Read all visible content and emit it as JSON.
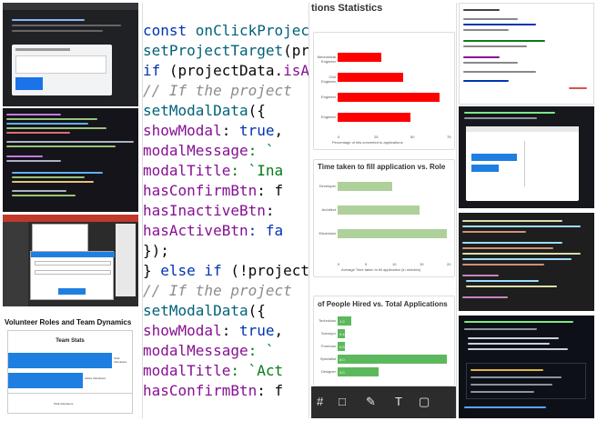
{
  "center_code": {
    "lines": [
      {
        "tokens": [
          {
            "t": "const ",
            "c": "kw"
          },
          {
            "t": "onClickProjectSt",
            "c": "fn"
          }
        ]
      },
      {
        "tokens": [
          {
            "t": "  setProjectTarget",
            "c": "fn"
          },
          {
            "t": "(pro",
            "c": "tx"
          }
        ]
      },
      {
        "tokens": [
          {
            "t": "  if ",
            "c": "kw"
          },
          {
            "t": "(projectData.",
            "c": "tx"
          },
          {
            "t": "isAc",
            "c": "pr"
          }
        ]
      },
      {
        "tokens": [
          {
            "t": "    // If the project",
            "c": "cm"
          }
        ]
      },
      {
        "tokens": [
          {
            "t": "    setModalData",
            "c": "fn"
          },
          {
            "t": "({",
            "c": "tx"
          }
        ]
      },
      {
        "tokens": [
          {
            "t": "      showModal",
            "c": "pr"
          },
          {
            "t": ": ",
            "c": "tx"
          },
          {
            "t": "true",
            "c": "kw"
          },
          {
            "t": ",",
            "c": "tx"
          }
        ]
      },
      {
        "tokens": [
          {
            "t": "      modalMessage",
            "c": "pr"
          },
          {
            "t": ": `",
            "c": "st"
          }
        ]
      },
      {
        "tokens": [
          {
            "t": "      modalTitle",
            "c": "pr"
          },
          {
            "t": ": `Ina",
            "c": "st"
          }
        ]
      },
      {
        "tokens": [
          {
            "t": "      hasConfirmBtn",
            "c": "pr"
          },
          {
            "t": ": f",
            "c": "tx"
          }
        ]
      },
      {
        "tokens": [
          {
            "t": "      hasInactiveBtn",
            "c": "pr"
          },
          {
            "t": ":",
            "c": "tx"
          }
        ]
      },
      {
        "tokens": [
          {
            "t": "      hasActiveBtn",
            "c": "pr"
          },
          {
            "t": ": fa",
            "c": "kw"
          }
        ]
      },
      {
        "tokens": [
          {
            "t": "    });",
            "c": "tx"
          }
        ]
      },
      {
        "tokens": [
          {
            "t": "  } ",
            "c": "tx"
          },
          {
            "t": "else if ",
            "c": "kw"
          },
          {
            "t": "(!projectD",
            "c": "tx"
          }
        ]
      },
      {
        "tokens": [
          {
            "t": "    // If the project",
            "c": "cm"
          }
        ]
      },
      {
        "tokens": [
          {
            "t": "    setModalData",
            "c": "fn"
          },
          {
            "t": "({",
            "c": "tx"
          }
        ]
      },
      {
        "tokens": [
          {
            "t": "      showModal",
            "c": "pr"
          },
          {
            "t": ": ",
            "c": "tx"
          },
          {
            "t": "true",
            "c": "kw"
          },
          {
            "t": ",",
            "c": "tx"
          }
        ]
      },
      {
        "tokens": [
          {
            "t": "      modalMessage",
            "c": "pr"
          },
          {
            "t": ": `",
            "c": "st"
          }
        ]
      },
      {
        "tokens": [
          {
            "t": "      modalTitle",
            "c": "pr"
          },
          {
            "t": ": `Act",
            "c": "st"
          }
        ]
      },
      {
        "tokens": [
          {
            "t": "      hasConfirmBtn",
            "c": "pr"
          },
          {
            "t": ": f",
            "c": "tx"
          }
        ]
      }
    ]
  },
  "charts_tile": {
    "header": "tions Statistics",
    "chart1": {
      "title": "",
      "subtitle": "Percentage of hits converted to applications",
      "color": "#ff0000",
      "categories": [
        "Mechanical Engineer",
        "Civil Engineer",
        "Engineer",
        "Engineer"
      ],
      "values": [
        30,
        45,
        70,
        50
      ],
      "ticks": [
        "0",
        "25",
        "50",
        "75"
      ]
    },
    "chart2": {
      "title": "Time taken to fill application vs. Role",
      "subtitle": "Average Time taken to fill application (in minutes)",
      "color": "#aed09b",
      "categories": [
        "Developer",
        "Architect",
        "Electrician"
      ],
      "values": [
        10,
        15,
        20
      ],
      "ticks": [
        "0",
        "5",
        "10",
        "15",
        "20"
      ]
    },
    "chart3": {
      "title": "of People Hired vs. Total Applications",
      "color": "#5cb85c",
      "categories": [
        "Technician",
        "Surveyor",
        "Foreman",
        "Specialist",
        "Designer"
      ],
      "values": [
        1,
        0.4,
        0.5,
        8,
        3
      ],
      "labels": [
        "1.0",
        "0.4",
        "0.5",
        "8.0",
        "3.0"
      ]
    },
    "toolbar_icons": [
      "frame-icon",
      "shape-icon",
      "pen-icon",
      "text-icon",
      "comment-icon"
    ]
  },
  "team_stats": {
    "heading": "Volunteer Roles and Team Dynamics",
    "panel_title": "Team Stats",
    "bars": [
      {
        "label": "Total Volunteers",
        "value": 100
      },
      {
        "label": "Active Volunteers",
        "value": 65
      }
    ],
    "axis_label": "Total Volunteers"
  },
  "colors": {
    "accent_blue": "#1e7fe0",
    "red_bar": "#ff0000",
    "green_bar": "#aed09b",
    "green_bar2": "#5cb85c"
  }
}
